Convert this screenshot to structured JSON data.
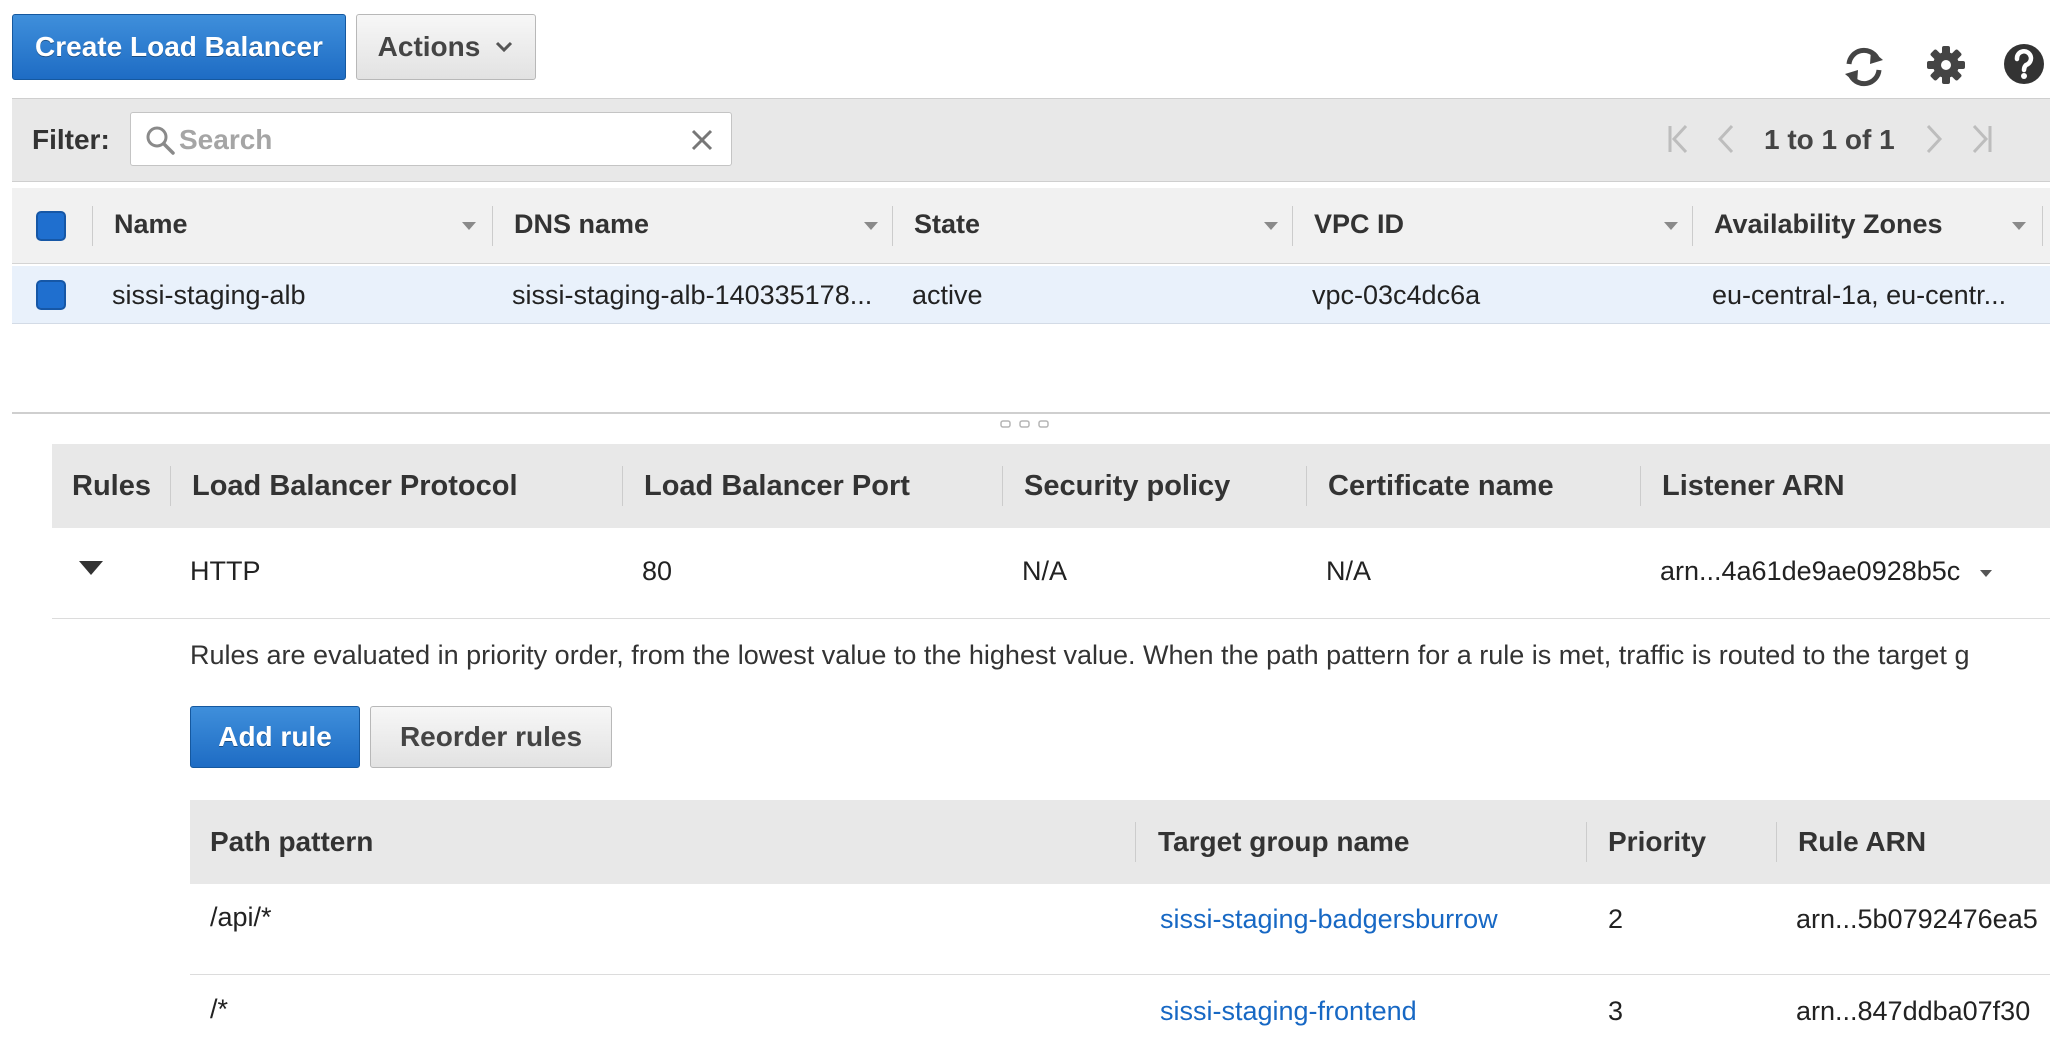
{
  "toolbar": {
    "create_label": "Create Load Balancer",
    "actions_label": "Actions",
    "refresh_icon": "refresh-icon",
    "settings_icon": "gear-icon",
    "help_icon": "help-icon"
  },
  "filter": {
    "label": "Filter:",
    "placeholder": "Search",
    "pagination": "1 to 1 of 1"
  },
  "lb_table": {
    "columns": [
      "Name",
      "DNS name",
      "State",
      "VPC ID",
      "Availability Zones"
    ],
    "rows": [
      {
        "name": "sissi-staging-alb",
        "dns": "sissi-staging-alb-140335178...",
        "state": "active",
        "vpc": "vpc-03c4dc6a",
        "azs": "eu-central-1a, eu-centr..."
      }
    ]
  },
  "listeners": {
    "columns": [
      "Rules",
      "Load Balancer Protocol",
      "Load Balancer Port",
      "Security policy",
      "Certificate name",
      "Listener ARN"
    ],
    "row": {
      "protocol": "HTTP",
      "port": "80",
      "security_policy": "N/A",
      "certificate": "N/A",
      "listener_arn": "arn...4a61de9ae0928b5c"
    }
  },
  "rules": {
    "description": "Rules are evaluated in priority order, from the lowest value to the highest value. When the path pattern for a rule is met, traffic is routed to the target g",
    "add_rule_label": "Add rule",
    "reorder_label": "Reorder rules",
    "columns": [
      "Path pattern",
      "Target group name",
      "Priority",
      "Rule ARN"
    ],
    "rows": [
      {
        "path": "/api/*",
        "target": "sissi-staging-badgersburrow",
        "priority": "2",
        "arn": "arn...5b0792476ea5"
      },
      {
        "path": "/*",
        "target": "sissi-staging-frontend",
        "priority": "3",
        "arn": "arn...847ddba07f30"
      }
    ]
  },
  "colors": {
    "primary": "#1e6cc4",
    "link": "#1768c4",
    "selected_row": "#e9f1fb",
    "header_bg": "#e8e8e8"
  }
}
